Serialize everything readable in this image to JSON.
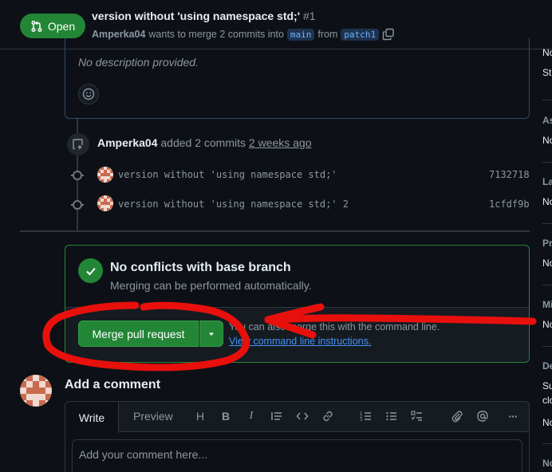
{
  "header": {
    "state_label": "Open",
    "title": "version without 'using namespace std;'",
    "number": "#1",
    "author": "Amperka04",
    "merge_text": "wants to merge 2 commits into",
    "base_branch": "main",
    "from_text": "from",
    "head_branch": "patch1"
  },
  "description": {
    "text": "No description provided."
  },
  "timeline": {
    "actor": "Amperka04",
    "action": "added 2 commits",
    "time": "2 weeks ago",
    "commits": [
      {
        "message": "version without 'using namespace std;'",
        "sha": "7132718"
      },
      {
        "message": "version without 'using namespace std;' 2",
        "sha": "1cfdf9b"
      }
    ]
  },
  "merge": {
    "title": "No conflicts with base branch",
    "subtitle": "Merging can be performed automatically.",
    "button_label": "Merge pull request",
    "cmd_text": "You can also merge this with the command line.",
    "cmd_link": "View command line instructions."
  },
  "comment": {
    "heading": "Add a comment",
    "tab_write": "Write",
    "tab_preview": "Preview",
    "placeholder": "Add your comment here...",
    "toolbar_icons": [
      "heading-icon",
      "bold-icon",
      "italic-icon",
      "quote-icon",
      "code-icon",
      "link-icon",
      "ordered-list-icon",
      "unordered-list-icon",
      "task-list-icon",
      "attach-icon",
      "mention-icon",
      "more-icon"
    ],
    "toolbar_glyphs": {
      "heading": "H",
      "bold": "B",
      "italic": "I",
      "more": "···"
    }
  },
  "sidebar": {
    "items": [
      {
        "kind": "text",
        "label": "No"
      },
      {
        "kind": "text",
        "label": "St"
      },
      {
        "kind": "head",
        "label": "As"
      },
      {
        "kind": "text",
        "label": "No"
      },
      {
        "kind": "head",
        "label": "La"
      },
      {
        "kind": "text",
        "label": "No"
      },
      {
        "kind": "head",
        "label": "Pr"
      },
      {
        "kind": "text",
        "label": "No"
      },
      {
        "kind": "head",
        "label": "Mi"
      },
      {
        "kind": "text",
        "label": "No"
      },
      {
        "kind": "head",
        "label": "De"
      },
      {
        "kind": "text",
        "label": "Su"
      },
      {
        "kind": "text",
        "label": "clo"
      },
      {
        "kind": "text",
        "label": "No"
      },
      {
        "kind": "head",
        "label": "No"
      }
    ]
  },
  "colors": {
    "accent_green": "#238636",
    "link_blue": "#4493f8",
    "annotation_red": "#e8100c",
    "background": "#0d1117"
  }
}
